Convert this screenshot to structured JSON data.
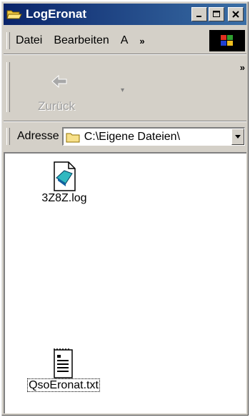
{
  "window": {
    "title": "LogEronat",
    "icon": "folder-open-icon",
    "controls": {
      "minimize": "_",
      "maximize": "□",
      "close": "✕"
    }
  },
  "menu": {
    "items": [
      {
        "label": "Datei",
        "icon": null
      },
      {
        "label": "Bearbeiten",
        "icon": null
      },
      {
        "label": "A",
        "icon": null
      }
    ],
    "more": "»",
    "logo": "windows-logo-icon"
  },
  "toolbar": {
    "back_label": "Zurück",
    "back_icon": "back-arrow-icon",
    "dropdown": "▾",
    "more": "»"
  },
  "address": {
    "label": "Adresse",
    "value": "C:\\Eigene Dateien\\",
    "icon": "folder-icon"
  },
  "files": [
    {
      "name": "3Z8Z.log",
      "icon": "log-file-icon",
      "selected": false
    },
    {
      "name": "QsoEronat.txt",
      "icon": "text-file-icon",
      "selected": true
    }
  ],
  "colors": {
    "titlebar_start": "#0a246a",
    "titlebar_end": "#3a6ea5",
    "chrome": "#d4d0c8"
  }
}
